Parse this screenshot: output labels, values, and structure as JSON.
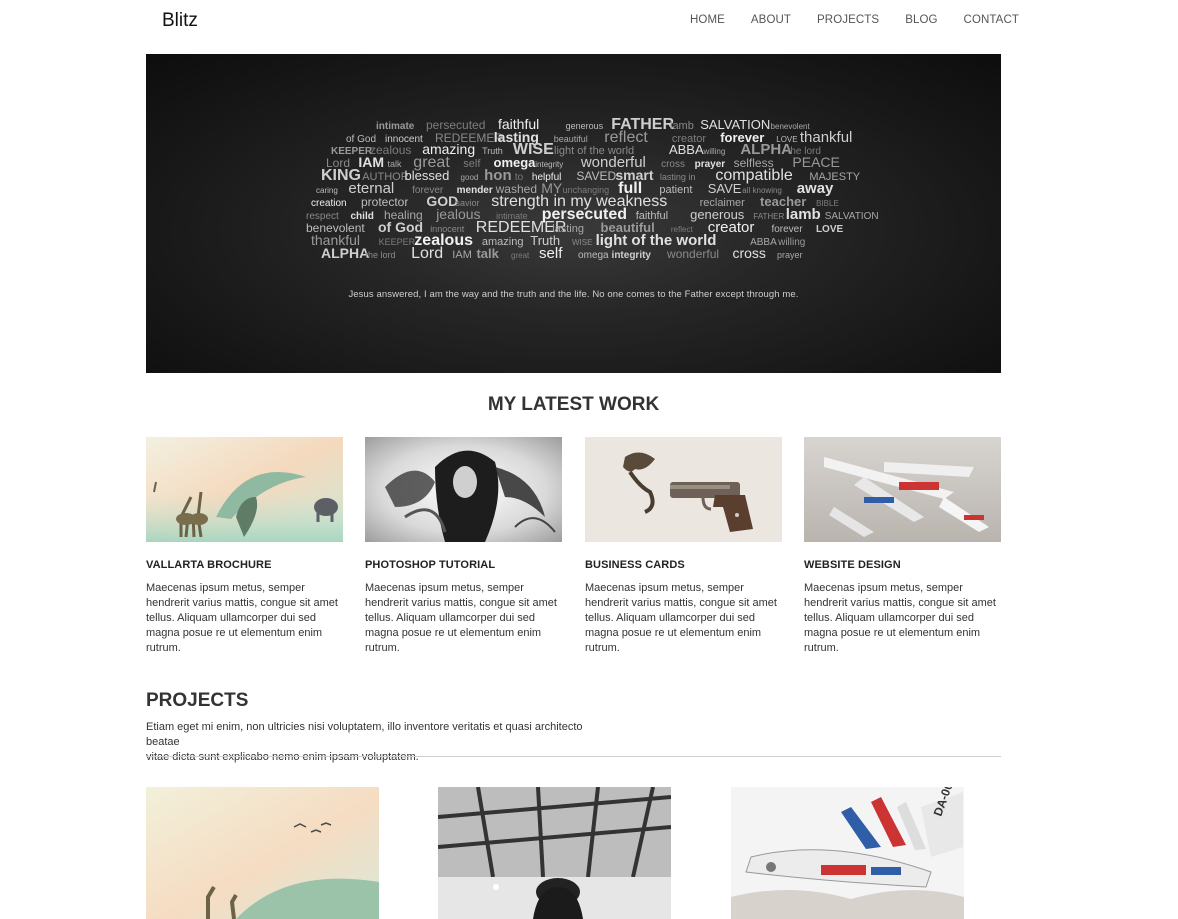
{
  "header": {
    "logo": "Blitz",
    "nav": [
      "HOME",
      "ABOUT",
      "PROJECTS",
      "BLOG",
      "CONTACT"
    ]
  },
  "hero": {
    "words": [
      "intimate",
      "persecuted",
      "faithful",
      "generous",
      "FATHER",
      "lamb",
      "SALVATION",
      "benevolent",
      "of God",
      "innocent",
      "REDEEMER",
      "lasting",
      "beautiful",
      "reflect",
      "creator",
      "forever",
      "LOVE",
      "thankful",
      "KEEPER",
      "zealous",
      "amazing",
      "Truth",
      "WISE",
      "light of the world",
      "ABBA",
      "willing",
      "ALPHA",
      "the lord",
      "Lord",
      "IAM",
      "talk",
      "great",
      "self",
      "omega",
      "integrity",
      "wonderful",
      "cross",
      "prayer",
      "selfless",
      "PEACE",
      "KING",
      "AUTHOR",
      "blessed",
      "good",
      "hon",
      "to",
      "helpful",
      "SAVED",
      "smart",
      "lasting in",
      "compatible",
      "MAJESTY",
      "caring",
      "eternal",
      "forever",
      "mender",
      "washed",
      "MY",
      "unchanging",
      "full",
      "patient",
      "SAVE",
      "all knowing",
      "away",
      "creation",
      "protector",
      "GOD",
      "savior",
      "strength in my weakness",
      "reclaimer",
      "teacher",
      "BIBLE",
      "respect",
      "child",
      "healing",
      "jealous"
    ],
    "quote": "Jesus answered, I am the way and the truth and the life. No one comes to the Father except through me."
  },
  "latest_work": {
    "title": "MY LATEST WORK",
    "items": [
      {
        "title": "VALLARTA BROCHURE",
        "desc": "Maecenas ipsum metus, semper hendrerit varius mattis, congue sit amet tellus. Aliquam ullamcorper dui sed magna posue re ut elementum enim rutrum."
      },
      {
        "title": "PHOTOSHOP TUTORIAL",
        "desc": "Maecenas ipsum metus, semper hendrerit varius mattis, congue sit amet tellus. Aliquam ullamcorper dui sed magna posue re ut elementum enim rutrum."
      },
      {
        "title": "BUSINESS CARDS",
        "desc": "Maecenas ipsum metus, semper hendrerit varius mattis, congue sit amet tellus. Aliquam ullamcorper dui sed magna posue re ut elementum enim rutrum."
      },
      {
        "title": "WEBSITE DESIGN",
        "desc": "Maecenas ipsum metus, semper hendrerit varius mattis, congue sit amet tellus. Aliquam ullamcorper dui sed magna posue re ut elementum enim rutrum."
      }
    ]
  },
  "projects": {
    "title": "PROJECTS",
    "desc": "Etiam eget mi enim, non ultricies nisi voluptatem, illo inventore veritatis et quasi architecto beatae\n vitae dicta sunt explicabo nemo enim ipsam voluptatem."
  },
  "colors": {
    "hero_bg": "#1a1a1a",
    "text": "#333333",
    "nav_text": "#555555",
    "divider": "#cfcfcf"
  }
}
